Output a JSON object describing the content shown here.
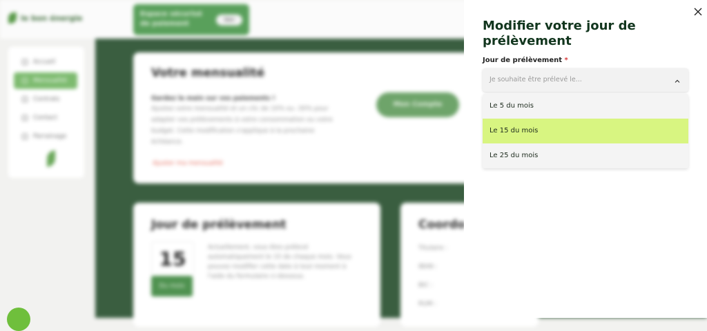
{
  "background": {
    "logo_text": "le bon énergie",
    "banner": {
      "text": "Espace sécurisé de paiement",
      "button": "Voir"
    },
    "sidebar": {
      "items": [
        {
          "label": "Accueil",
          "active": false
        },
        {
          "label": "Mensualité",
          "active": true
        },
        {
          "label": "Contrats",
          "active": false
        },
        {
          "label": "Contact",
          "active": false
        },
        {
          "label": "Parrainage",
          "active": false
        }
      ]
    },
    "monthly_card": {
      "title": "Votre mensualité",
      "question": "Gardez la main sur vos paiements !",
      "text": "Ajustez votre mensualité et un clic de 10% ou -30% pour adapter vos prélèvements à votre consommation ou votre budget. Cette modification s'applique à la prochaine échéance.",
      "link": "Ajuster ma mensualité",
      "button": "Mon Compte"
    },
    "debit_card": {
      "title": "Jour de prélèvement",
      "day": "15",
      "day_button": "Du mois",
      "text": "Actuellement, vous êtes prélevé automatiquement le 15 de chaque mois. Vous pouvez modifier cette date à tout moment à l'aide du formulaire ci-dessous."
    },
    "coords_card": {
      "title": "Coordo",
      "lines": [
        "Titulaire :",
        "IBAN :",
        "BIC :",
        "RUM :"
      ]
    }
  },
  "drawer": {
    "title": "Modifier votre jour de prélèvement",
    "field_label": "Jour de prélèvement",
    "required_mark": "*",
    "select_placeholder": "Je souhaite être prélevé le...",
    "options": [
      {
        "label": "Le 5 du mois",
        "selected": false
      },
      {
        "label": "Le 15 du mois",
        "selected": true
      },
      {
        "label": "Le 25 du mois",
        "selected": false
      }
    ]
  },
  "colors": {
    "dark_green": "#3a5e40",
    "title_green": "#12361e",
    "highlight": "#d8f581",
    "required": "#d93b3b"
  }
}
